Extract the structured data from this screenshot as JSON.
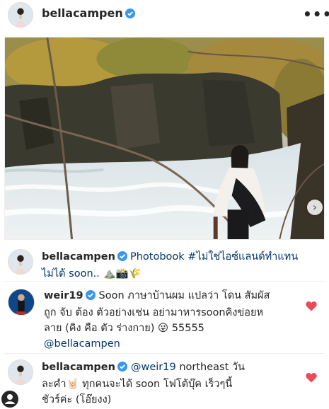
{
  "post": {
    "username": "bellacampen",
    "more_icon": "more-horizontal-icon",
    "verified_color": "#3897f0"
  },
  "caption": {
    "username": "bellacampen",
    "text_line1": "Photobook #ไม่ใช่ไอซ์แลนด์ทำแทน",
    "text_line2": "ไม่ได้ soon.. ⛰️📸🌾"
  },
  "comments": [
    {
      "username": "weir19",
      "line1": "Soon ภาษาบ้านผม แปลว่า โดน สัมผัส",
      "line2": "ถูก จับ ต้อง ตัวอย่างเช่น อย่ามาหารsoonคิงข่อยห",
      "line3": "ลาย (คิง คือ ตัว ร่างกาย) 😜 55555",
      "mention": "@bellacampen",
      "liked": true
    },
    {
      "username": "bellacampen",
      "mention": "@weir19",
      "line1_rest": "northeast วัน",
      "line2": "ละคำ🤘🏻 ทุกคนจะได้ soon โฟโต้บุ๊ค เร็วๆนี้",
      "line3": "ชัวร์ค่ะ (โอ๊ยงง)",
      "liked": true
    }
  ],
  "colors": {
    "heart": "#ed4956",
    "mention": "#003569",
    "text": "#262626"
  }
}
